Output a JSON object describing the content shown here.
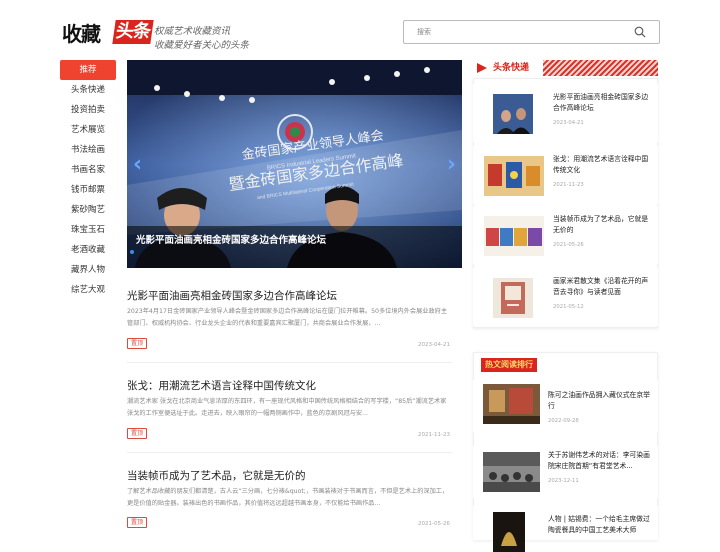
{
  "header": {
    "logo_part1": "收藏",
    "logo_part2": "头条",
    "slogan_line1": "权威艺术收藏资讯",
    "slogan_line2": "收藏爱好者关心的头条",
    "search_placeholder": "搜索"
  },
  "nav": {
    "items": [
      "推荐",
      "头条快递",
      "投资拍卖",
      "艺术展览",
      "书法绘画",
      "书画名家",
      "钱币邮票",
      "紫砂陶艺",
      "珠宝玉石",
      "老酒收藏",
      "藏界人物",
      "综艺大观"
    ]
  },
  "hero": {
    "title": "光影平面油画亮相金砖国家多边合作高峰论坛",
    "banner_line1": "金砖国家产业领导人峰会",
    "banner_line2": "暨金砖国家多边合作高峰",
    "banner_en1": "BRICS Industrial Leaders Summit",
    "banner_en2": "and BRICS Multilateral Cooperation Summit"
  },
  "articles": [
    {
      "title": "光影平面油画亮相金砖国家多边合作高峰论坛",
      "summary": "2023年4月17日金砖国家产业领导人峰会暨金砖国家多边合作高峰论坛在厦门拉开帷幕。50多位境内外会展业政府主管部门、权威机构协会、行业龙头企业的代表和重要嘉宾汇聚厦门，共商会展业合作发展，...",
      "tag": "置顶",
      "date": "2023-04-21"
    },
    {
      "title": "张戈：用潮流艺术语言诠释中国传统文化",
      "summary": "潮流艺术家 张戈在北京商业气息浓厚的东四环，有一座现代风格和中国传统风格相结合的写字楼，“85后”潮流艺术家张戈的工作室便选址于此。走进去，映入眼帘的一幅两侧画作中，蓝色的京剧风冠与安...",
      "tag": "置顶",
      "date": "2021-11-23"
    },
    {
      "title": "当装帧币成为了艺术品，它就是无价的",
      "summary": "了解艺术品收藏的朋友们都清楚，古人云“三分画，七分裱&quot;，书画装裱对于书画而言，不但是艺术上的深加工，更是价值的贴金器。装裱出色的书画作品，其价值将远远超越书画本身，不仅能给书画作品...",
      "tag": "置顶",
      "date": "2021-05-26"
    }
  ],
  "kuaidi": {
    "heading": "头条快递",
    "items": [
      {
        "title": "光影平面油画亮相金砖国家多边合作高峰论坛",
        "date": "2023-04-21"
      },
      {
        "title": "张戈：用潮流艺术语言诠释中国传统文化",
        "date": "2021-11-23"
      },
      {
        "title": "当装帧币成为了艺术品，它就是无价的",
        "date": "2021-05-26"
      },
      {
        "title": "画家米君散文集《沿着花开的声音去寻你》与读者见面",
        "date": "2021-05-12"
      }
    ]
  },
  "ranking": {
    "heading": "热文阅读排行",
    "items": [
      {
        "title": "陈可之油画作品拥入藏仪式在京举行",
        "date": "2022-09-28"
      },
      {
        "title": "关于苏谢伟艺术的对话：李可染画院宋庄院首期“有君堂艺术...",
        "date": "2023-12-11"
      },
      {
        "title": "人物 | 姑锡费：一个给毛主席做过陶瓷餐具的中国工艺美术大师",
        "date": ""
      }
    ]
  },
  "colors": {
    "brand_red": "#d9251c",
    "nav_active": "#f0432f",
    "tag_red": "#e04a3a"
  }
}
